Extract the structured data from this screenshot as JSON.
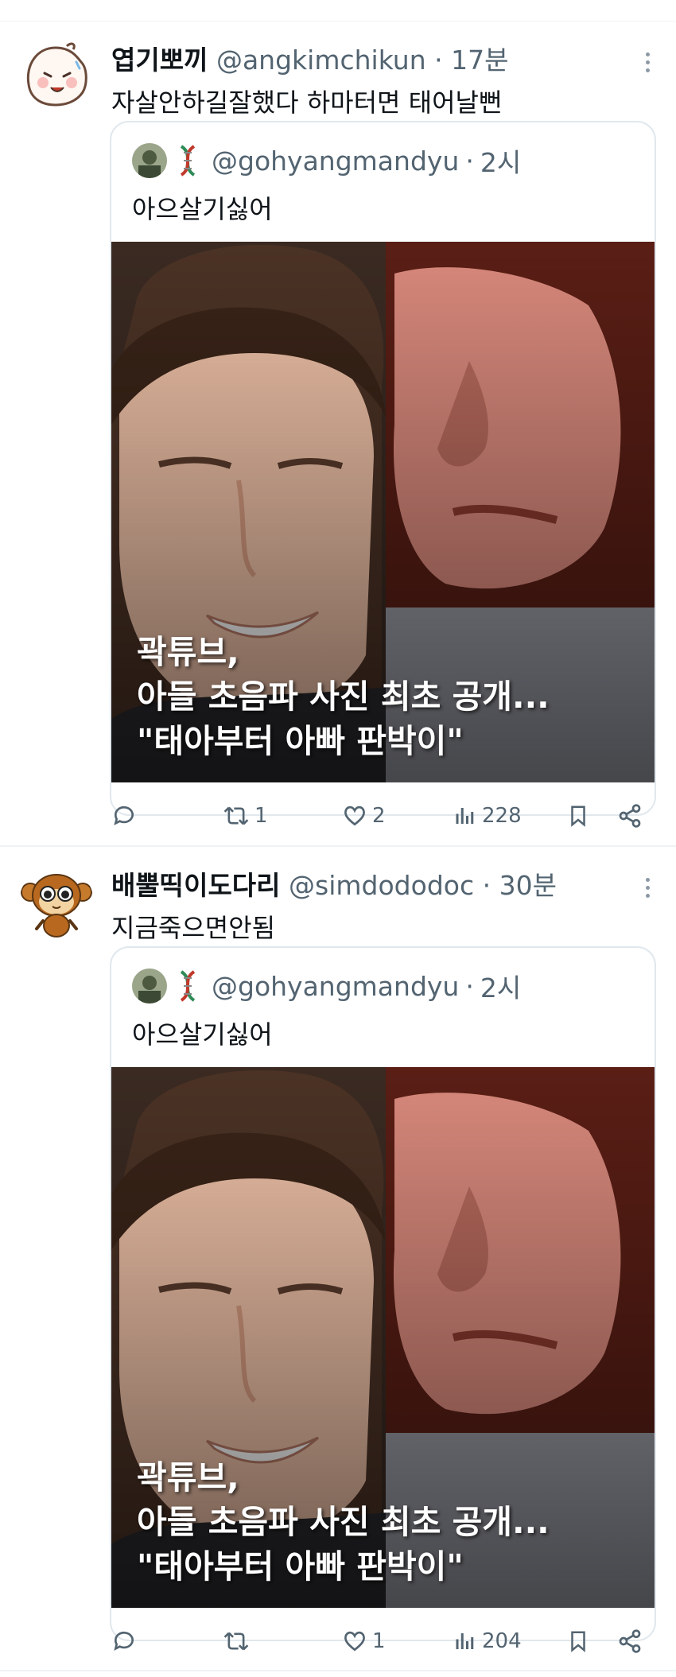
{
  "tweets": [
    {
      "name": "엽기뽀끼",
      "handle": "@angkimchikun",
      "sep": "·",
      "time": "17분",
      "text": "자살안하길잘했다 하마터면 태어날뻔",
      "quote": {
        "handle": "@gohyangmandyu",
        "sep": "·",
        "time": "2시",
        "text": "아으살기싫어",
        "caption": [
          "곽튜브,",
          "아들 초음파 사진 최초 공개...",
          "\"태아부터 아빠 판박이\""
        ]
      },
      "actions": {
        "replies": "",
        "retweets": "1",
        "likes": "2",
        "views": "228"
      }
    },
    {
      "name": "배뿔띡이도다리",
      "handle": "@simdododoc",
      "sep": "·",
      "time": "30분",
      "text": "지금죽으면안됨",
      "quote": {
        "handle": "@gohyangmandyu",
        "sep": "·",
        "time": "2시",
        "text": "아으살기싫어",
        "caption": [
          "곽튜브,",
          "아들 초음파 사진 최초 공개...",
          "\"태아부터 아빠 판박이\""
        ]
      },
      "actions": {
        "replies": "",
        "retweets": "",
        "likes": "1",
        "views": "204"
      }
    }
  ],
  "colors": {
    "text": "#0f1419",
    "muted": "#536471",
    "border": "#e1e8ed"
  },
  "icons": [
    "reply-icon",
    "retweet-icon",
    "like-icon",
    "views-icon",
    "bookmark-icon",
    "share-icon",
    "more-icon"
  ]
}
